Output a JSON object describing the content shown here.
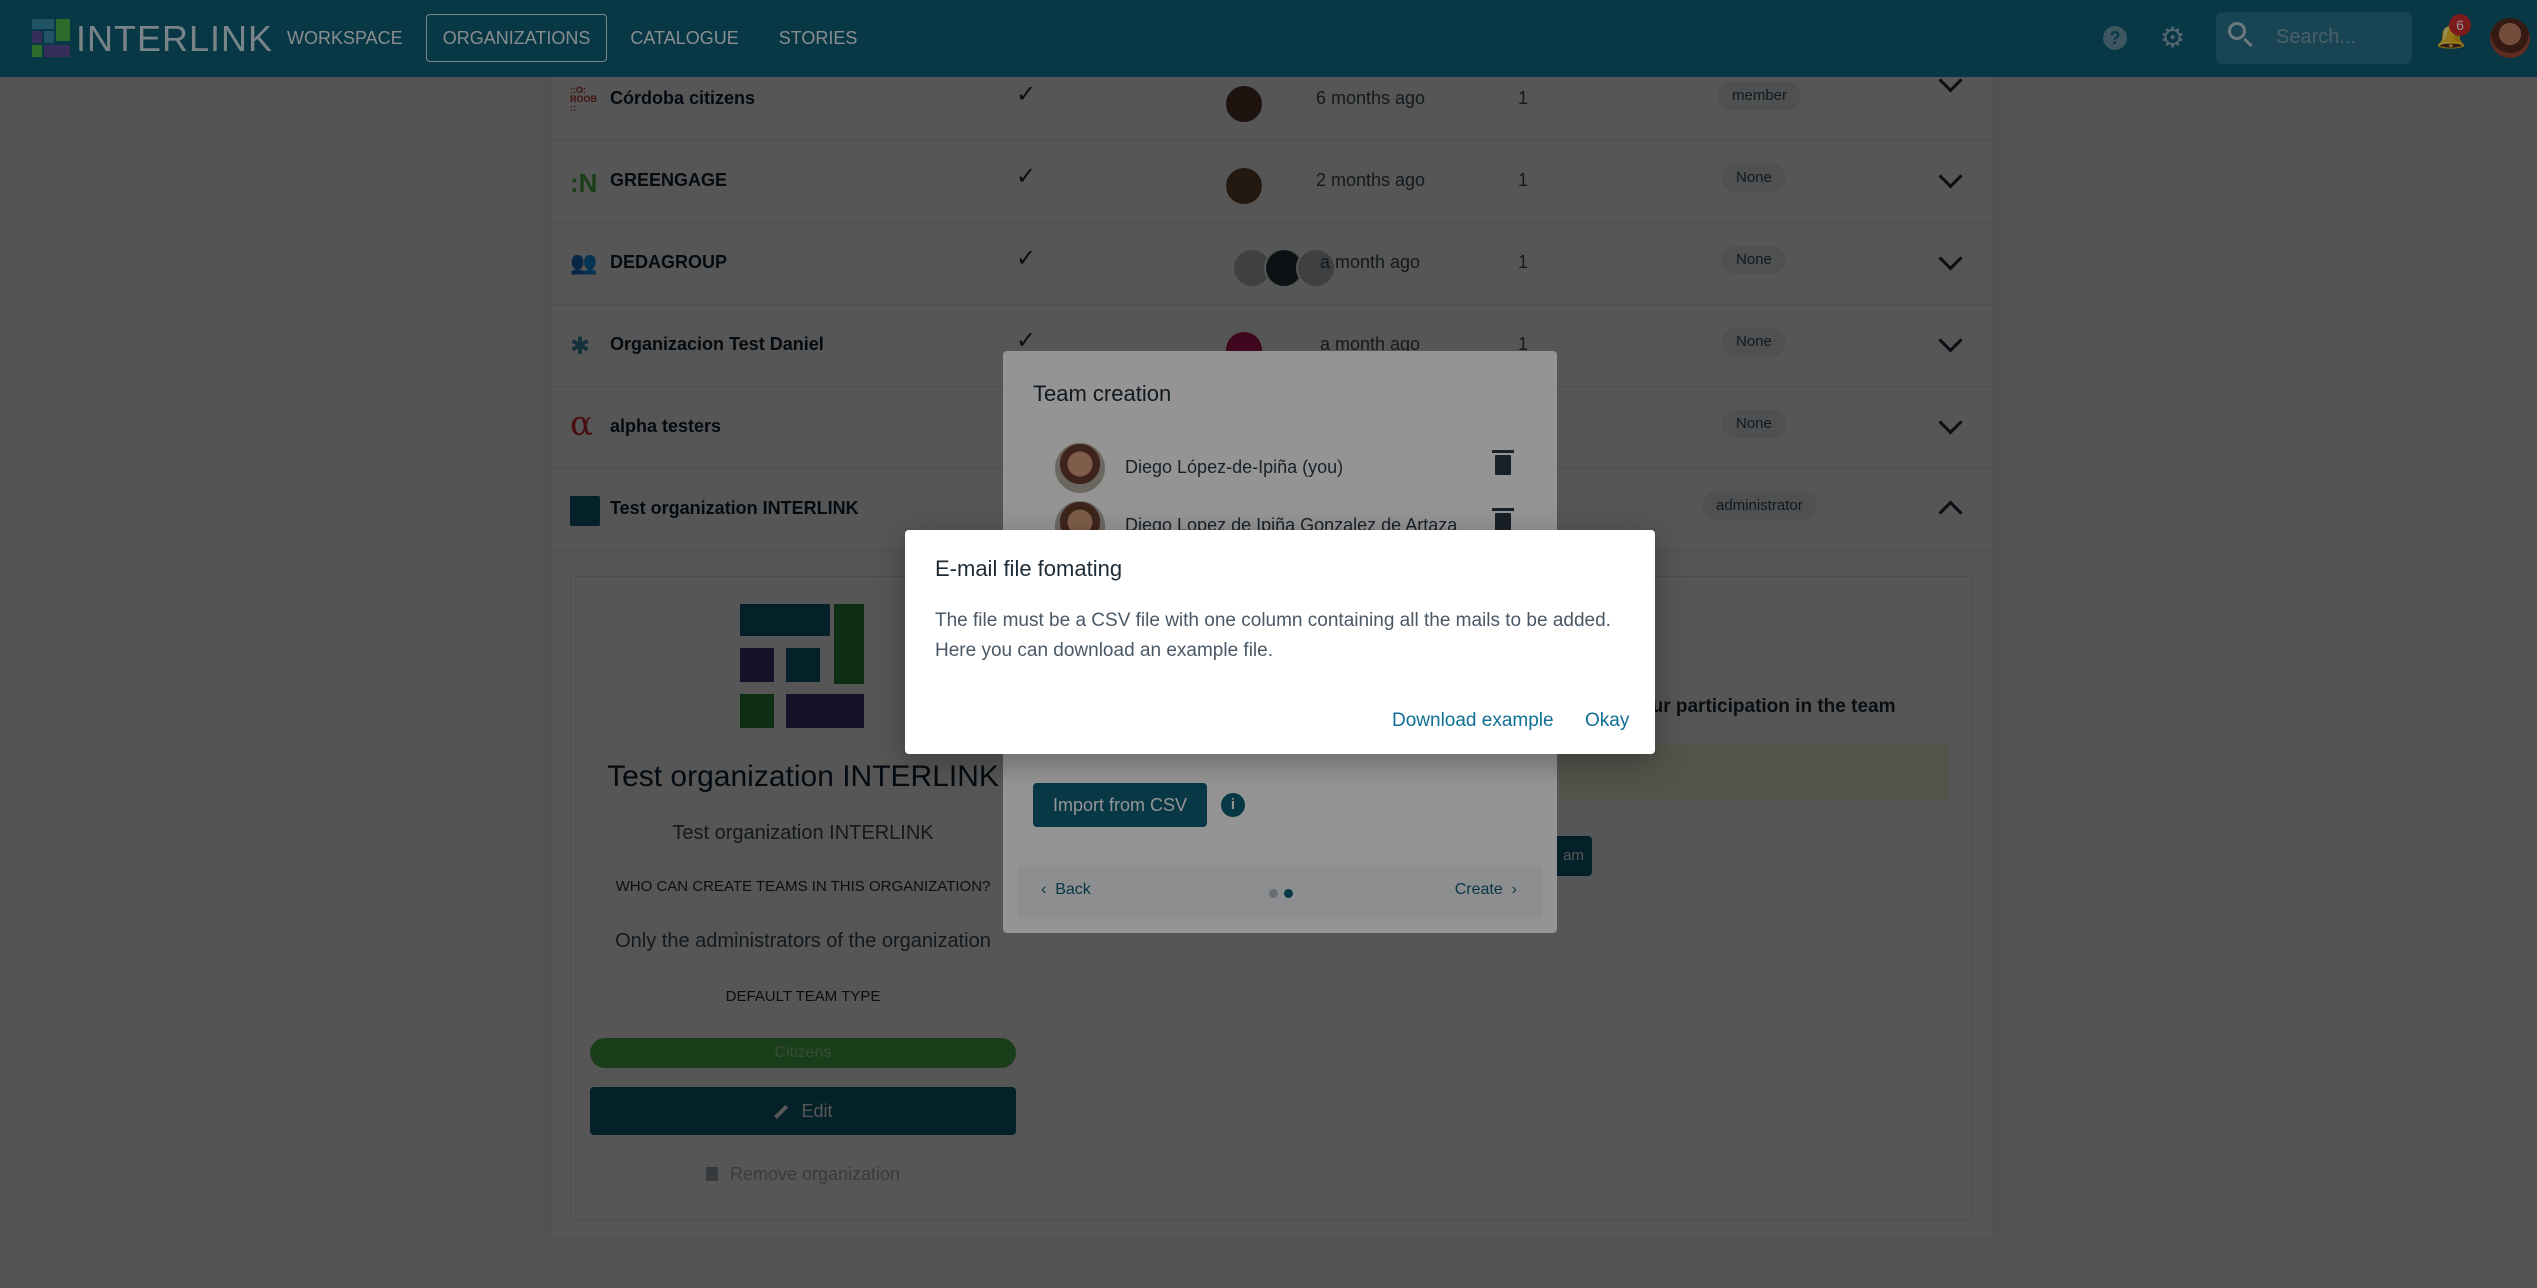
{
  "nav": {
    "logo_text": "INTERLINK",
    "items": [
      {
        "label": "WORKSPACE",
        "active": false
      },
      {
        "label": "ORGANIZATIONS",
        "active": true
      },
      {
        "label": "CATALOGUE",
        "active": false
      },
      {
        "label": "STORIES",
        "active": false
      }
    ],
    "search_placeholder": "Search...",
    "notification_count": "6",
    "icons": [
      "help-icon",
      "gear-icon",
      "search-icon",
      "bell-icon",
      "avatar"
    ]
  },
  "organizations": [
    {
      "name": "Córdoba citizens",
      "created": "6 months ago",
      "teams": "1",
      "role": "member"
    },
    {
      "name": "GREENGAGE",
      "created": "2 months ago",
      "teams": "1",
      "role": "None"
    },
    {
      "name": "DEDAGROUP",
      "created": "a month ago",
      "teams": "1",
      "role": "None"
    },
    {
      "name": "Organizacion Test Daniel",
      "created": "a month ago",
      "teams": "1",
      "role": "None"
    },
    {
      "name": "alpha testers",
      "created": "",
      "teams": "",
      "role": "None"
    },
    {
      "name": "Test organization INTERLINK",
      "created": "",
      "teams": "",
      "role": "administrator"
    }
  ],
  "detail": {
    "title": "Test organization INTERLINK",
    "description": "Test organization INTERLINK",
    "who_label": "WHO CAN CREATE TEAMS IN THIS ORGANIZATION?",
    "who_value": "Only the administrators of the organization",
    "default_type_label": "DEFAULT TEAM TYPE",
    "default_type_value": "Citizens",
    "edit_label": "Edit",
    "remove_label": "Remove organization",
    "behind_text": "our participation in the team",
    "behind_button": "am"
  },
  "team_modal": {
    "title": "Team creation",
    "members": [
      {
        "name": "Diego López-de-Ipiña (you)"
      },
      {
        "name": "Diego Lopez de Ipiña Gonzalez de Artaza"
      }
    ],
    "import_label": "Import from CSV",
    "info_icon": "i",
    "back_label": "Back",
    "create_label": "Create"
  },
  "email_modal": {
    "title": "E-mail file fomating",
    "body": "The file must be a CSV file with one column containing all the mails to be added. Here you can download an example file.",
    "download_label": "Download example",
    "ok_label": "Okay"
  },
  "colors": {
    "primary": "#0e5f78",
    "link": "#0e6f95",
    "citizens_chip": "#4fb84a",
    "badge": "#d63030"
  }
}
